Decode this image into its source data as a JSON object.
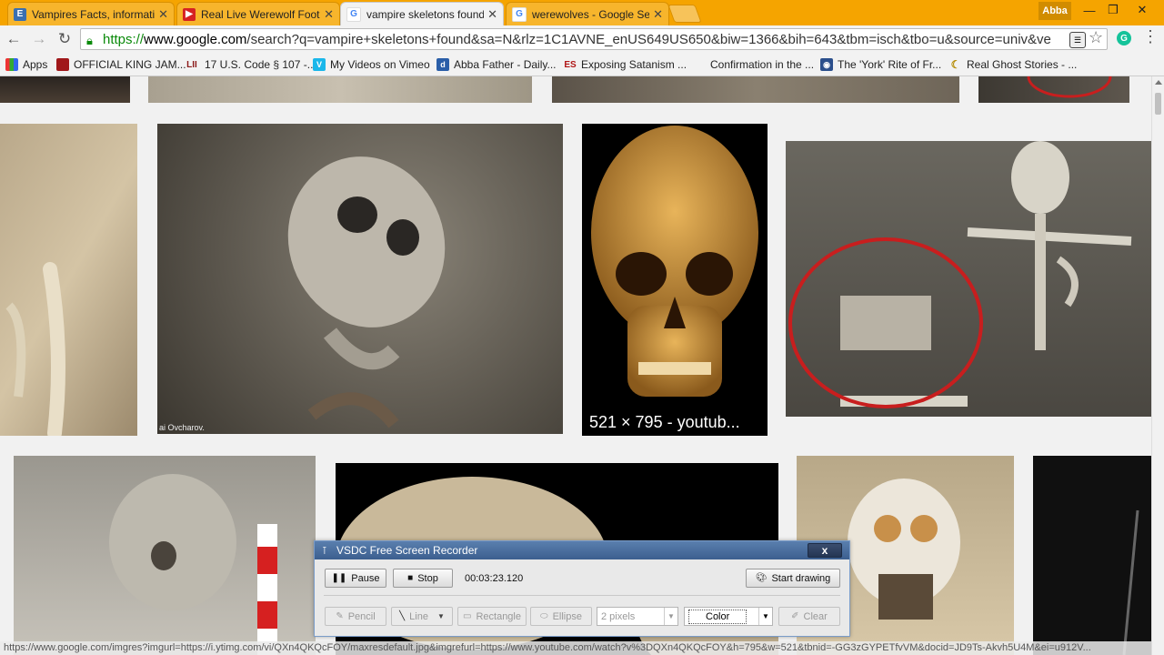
{
  "browser": {
    "tabs": [
      {
        "title": "Vampires Facts, informatio",
        "icon": "e-icon",
        "active": false
      },
      {
        "title": "Real Live Werewolf Footag",
        "icon": "youtube-icon",
        "active": false
      },
      {
        "title": "vampire skeletons found -",
        "icon": "google-icon",
        "active": true
      },
      {
        "title": "werewolves - Google Sear",
        "icon": "google-icon",
        "active": false
      }
    ],
    "profile": "Abba",
    "url_scheme": "https://",
    "url_host": "www.google.com",
    "url_rest": "/search?q=vampire+skeletons+found&sa=N&rlz=1C1AVNE_enUS649US650&biw=1366&bih=643&tbm=isch&tbo=u&source=univ&ve",
    "bookmarks": [
      {
        "label": "Apps",
        "icon": "apps-icon"
      },
      {
        "label": "OFFICIAL KING JAM...",
        "icon": "bible-icon"
      },
      {
        "label": "17 U.S. Code § 107 -...",
        "icon": "lii-icon",
        "prefix": "LII"
      },
      {
        "label": "My Videos on Vimeo",
        "icon": "vimeo-icon"
      },
      {
        "label": "Abba Father - Daily...",
        "icon": "page-icon"
      },
      {
        "label": "Exposing Satanism ...",
        "icon": "es-icon",
        "prefix": "ES"
      },
      {
        "label": "Confirmation in the ...",
        "icon": "blank-icon"
      },
      {
        "label": "The 'York' Rite of Fr...",
        "icon": "globe-icon"
      },
      {
        "label": "Real Ghost Stories - ...",
        "icon": "ghost-icon"
      }
    ]
  },
  "results": {
    "captions": {
      "skull_caption": "521 × 795 - youtub...",
      "credit": "ai Ovcharov."
    }
  },
  "recorder": {
    "title": "VSDC Free Screen Recorder",
    "close_label": "x",
    "pause_label": "Pause",
    "stop_label": "Stop",
    "elapsed": "00:03:23.120",
    "start_drawing_label": "Start drawing",
    "tools": {
      "pencil": "Pencil",
      "line": "Line",
      "rectangle": "Rectangle",
      "ellipse": "Ellipse",
      "width": "2 pixels",
      "color": "Color",
      "clear": "Clear"
    }
  },
  "status_url": "https://www.google.com/imgres?imgurl=https://i.ytimg.com/vi/QXn4QKQcFOY/maxresdefault.jpg&imgrefurl=https://www.youtube.com/watch?v%3DQXn4QKQcFOY&h=795&w=521&tbnid=-GG3zGYPETfvVM&docid=JD9Ts-Akvh5U4M&ei=u912V..."
}
